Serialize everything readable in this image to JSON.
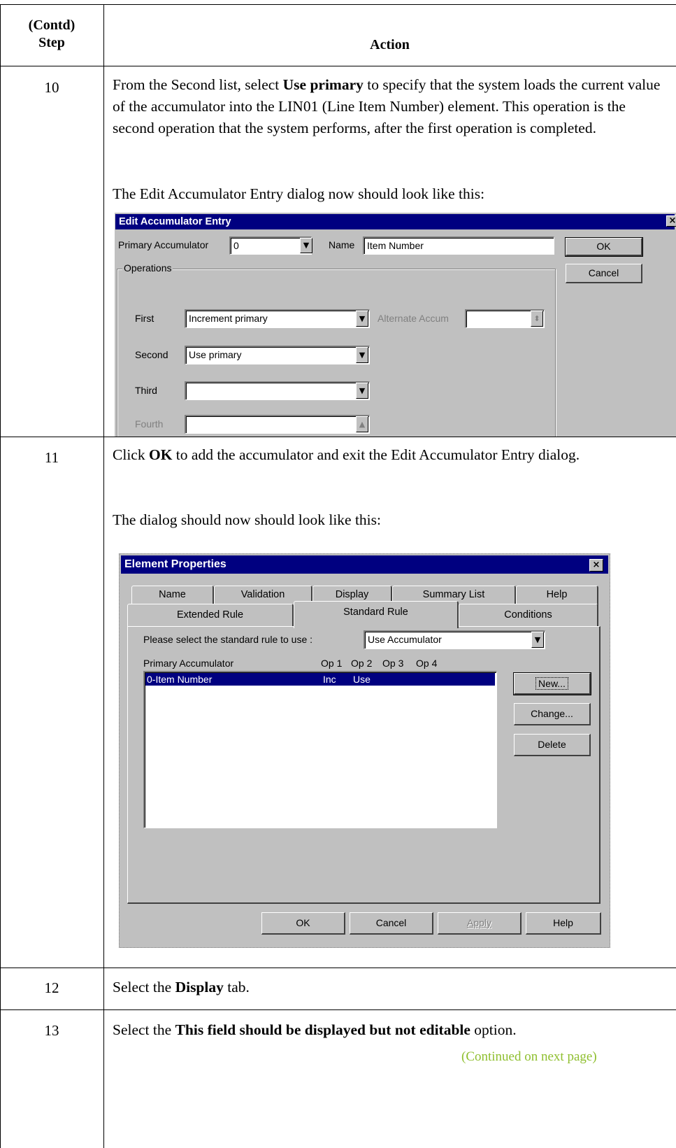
{
  "table": {
    "header_step": "(Contd)\nStep",
    "header_step_line1": "(Contd)",
    "header_step_line2": "Step",
    "header_action": "Action"
  },
  "steps": [
    {
      "number": "10",
      "text_parts": [
        "From the Second list, select ",
        "Use primary",
        " to specify that the system loads the current value of the accumulator into the LIN01 (Line Item Number) element. This operation is the second operation that the system performs, after the first operation is completed."
      ],
      "followup": "The Edit Accumulator Entry dialog now should look like this:"
    },
    {
      "number": "11",
      "text_parts": [
        "Click ",
        "OK",
        " to add the accumulator and exit the Edit Accumulator Entry dialog."
      ],
      "followup": "The dialog should now should look like this:"
    },
    {
      "number": "12",
      "text_parts": [
        "Select the ",
        "Display",
        " tab."
      ]
    },
    {
      "number": "13",
      "text_parts": [
        "Select the ",
        "This field should be displayed but not editable",
        " option."
      ]
    }
  ],
  "continued": "(Continued on next page)",
  "colors": {
    "continued": "#8fbf2f",
    "title_bar": "#000080",
    "dialog_face": "#c0c0c0"
  },
  "edit_accumulator_dialog": {
    "title": "Edit Accumulator Entry",
    "primary_accumulator_label": "Primary Accumulator",
    "primary_accumulator_value": "0",
    "name_label": "Name",
    "name_value": "Item Number",
    "ok_label": "OK",
    "cancel_label": "Cancel",
    "operations_label": "Operations",
    "first_label": "First",
    "first_value": "Increment primary",
    "alternate_label": "Alternate Accum",
    "second_label": "Second",
    "second_value": "Use primary",
    "third_label": "Third",
    "third_value": "",
    "fourth_label": "Fourth",
    "fourth_value": ""
  },
  "element_properties_dialog": {
    "title": "Element Properties",
    "tabs_back": [
      "Name",
      "Validation",
      "Display",
      "Summary List",
      "Help"
    ],
    "tabs_front": [
      "Extended Rule",
      "Standard Rule",
      "Conditions"
    ],
    "active_tab": "Standard Rule",
    "rule_label": "Please select the standard rule to use :",
    "rule_value": "Use Accumulator",
    "columns": [
      "Primary Accumulator",
      "Op 1",
      "Op 2",
      "Op 3",
      "Op 4"
    ],
    "rows": [
      {
        "name": "0-Item Number",
        "op1": "Inc",
        "op2": "Use",
        "op3": "",
        "op4": ""
      }
    ],
    "new_label": "New...",
    "change_label": "Change...",
    "delete_label": "Delete",
    "ok_label": "OK",
    "cancel_label": "Cancel",
    "apply_label": "Apply",
    "help_label": "Help"
  }
}
